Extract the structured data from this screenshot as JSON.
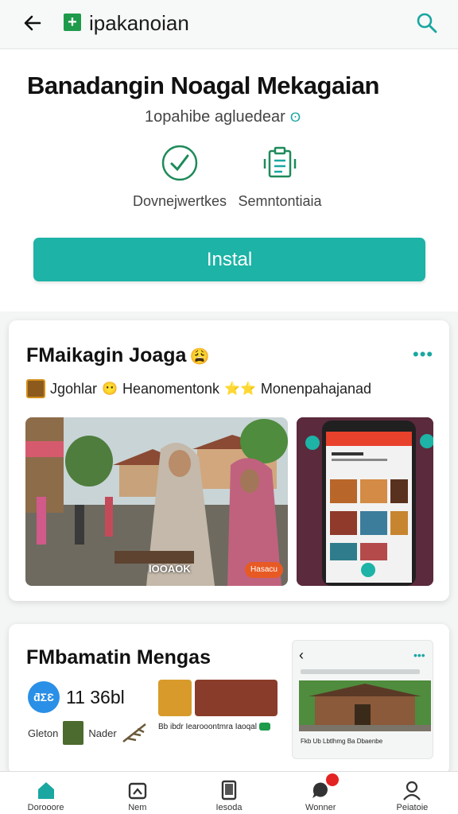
{
  "topbar": {
    "app_name": "ipakanoian",
    "logo_glyph": "+"
  },
  "header": {
    "title": "Banadangin Noagal Mekagaian",
    "subtitle": "1opahibe agluedear",
    "subtitle_icon": "ʘ",
    "features": [
      {
        "label": "Dovnejwertkes",
        "icon": "checkmark-badge-icon"
      },
      {
        "label": "Semntontiaia",
        "icon": "clipboard-list-icon"
      }
    ],
    "install_label": "Instal",
    "accent": "#1db3a6"
  },
  "card1": {
    "title": "FMaikagin Joaga",
    "title_emoji": "😩",
    "more": "•••",
    "tagline_a": "Jgohlar",
    "tagline_emoji_a": "😶",
    "tagline_b": "Heanomentonk",
    "tagline_emoji_b": "⭐⭐",
    "tagline_c": "Monenpahajanad",
    "photo_caption": "IOOAOK",
    "photo_cta": "Hasacu"
  },
  "card2": {
    "title": "FMbamatin Mengas",
    "badge": "ƌƩƐ",
    "stat_value": "11 36bl",
    "mini_a": "Gleton",
    "mini_b": "Nader",
    "strip_caption": "Bb ibdr Iearooontmra Iaoqal",
    "preview_back": "‹",
    "preview_more": "•••",
    "preview_caption": "Fkb Ub Lbtlhmg Ba Dbaenbe"
  },
  "bottomnav": [
    {
      "label": "Dorooore",
      "icon": "home-icon",
      "active": true
    },
    {
      "label": "Nem",
      "icon": "image-badge-icon"
    },
    {
      "label": "Iesoda",
      "icon": "tablet-icon"
    },
    {
      "label": "Wonner",
      "icon": "chat-notification-icon",
      "badge": true
    },
    {
      "label": "Peiatoie",
      "icon": "profile-icon"
    }
  ]
}
